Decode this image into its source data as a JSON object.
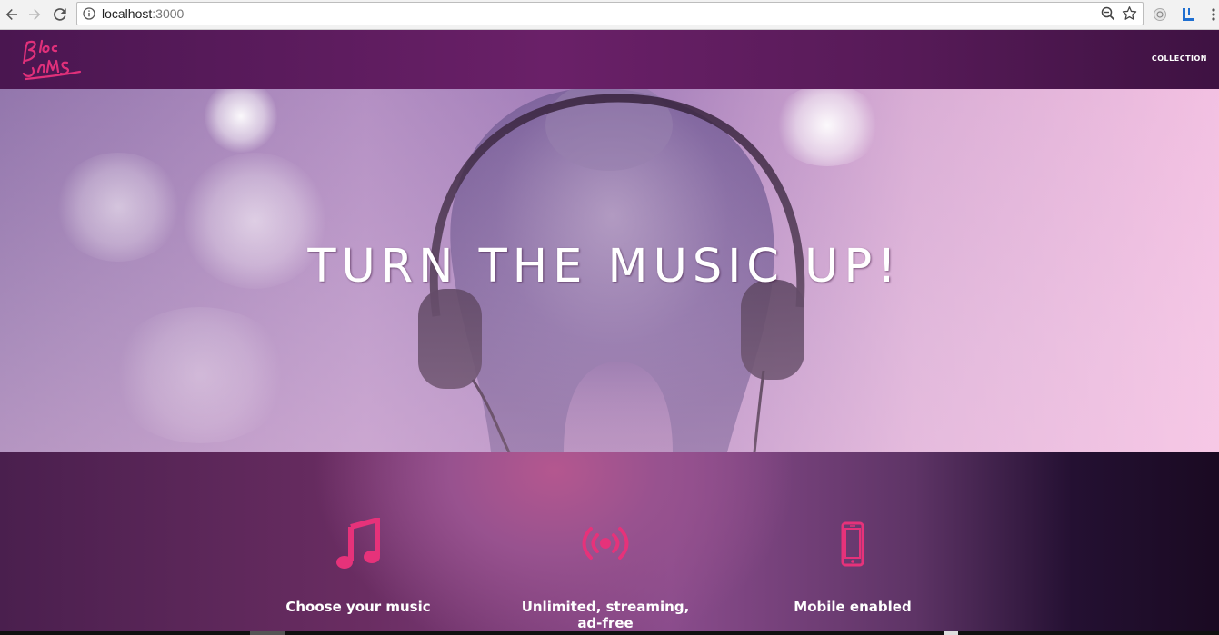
{
  "browser": {
    "url_host": "localhost",
    "url_port": ":3000"
  },
  "header": {
    "logo_icon": "bloc-jams-logo",
    "nav_collection": "COLLECTION"
  },
  "hero": {
    "title": "TURN THE MUSIC UP!"
  },
  "selling_points": [
    {
      "icon": "music-note-icon",
      "label": "Choose your music"
    },
    {
      "icon": "radio-broadcast-icon",
      "label": "Unlimited, streaming, ad-free"
    },
    {
      "icon": "mobile-phone-icon",
      "label": "Mobile enabled"
    }
  ],
  "colors": {
    "accent_pink": "#e6327a",
    "header_purple": "#5a1a5a"
  }
}
